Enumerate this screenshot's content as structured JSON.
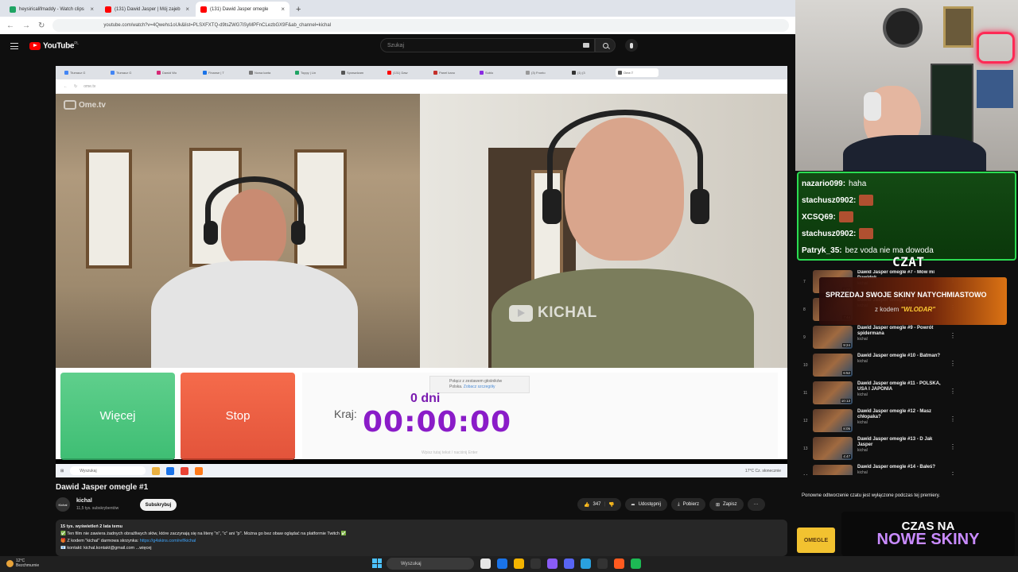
{
  "browser": {
    "tabs": [
      {
        "label": "heysiricalifmaddy - Watch clips",
        "color": "#1fa463"
      },
      {
        "label": "(131) Dawid Jasper | Mój zajeb",
        "color": "#ff0000"
      },
      {
        "label": "(131) Dawid Jasper omegle",
        "color": "#ff0000",
        "active": true
      }
    ],
    "new_tab": "+",
    "url": "youtube.com/watch?v=4Qwehs1oUk&list=PLSXFXTQ-d9tsZWG7iSyMPFnCLezbGX9F&ab_channel=kichal"
  },
  "youtube": {
    "logo": "YouTube",
    "logo_country": "PL",
    "search_placeholder": "Szukaj"
  },
  "player": {
    "inner_tabs": [
      "Tłumacz G",
      "Tłumacz G",
      "Dawid Wo",
      "Finanse | T",
      "Nowa karta",
      "Toppy | Lin",
      "Sprawdzam",
      "(131) Daw",
      "Panel kano",
      "Sublo",
      "(3) Fronto",
      "(1) (3",
      "Ome.T"
    ],
    "inner_url": "ome.tv",
    "site_logo": "Ome.tv",
    "watermark": "KICHAL",
    "more_button": "Więcej",
    "stop_button": "Stop",
    "country_label": "Kraj:",
    "days": "0 dni",
    "timer": "00:00:00",
    "notice_line1": "Połącz z zestawem głośników",
    "notice_line2a": "Polska.",
    "notice_line2b": "Zobacz szczegóły",
    "message_placeholder": "Wpisz tutaj tekst / naciśnij Enter",
    "taskbar_search": "Wyszukaj",
    "taskbar_tray": "17°C Cz. słonecznie"
  },
  "video": {
    "title": "Dawid Jasper omegle #1",
    "channel": "kichal",
    "channel_avatar": "Kichal",
    "subscribers": "11,5 tys. subskrybentów",
    "subscribe": "Subskrybuj",
    "likes": "347",
    "share": "Udostępnij",
    "download": "Pobierz",
    "save": "Zapisz",
    "more": "···",
    "desc_line1": "15 tys. wyświetleń  2 lata temu",
    "desc_line2": "✅ Ten film nie zawiera żadnych obraźliwych słów, które zaczynają się na literę \"n\", \"c\" ani \"p\". Można go bez obaw oglądać na platformie Twitch ✅",
    "desc_line3a": "🎁 Z kodem \"kichal\" darmowa skrzynka: ",
    "desc_line3b": "https://g4skins.com/ref/kichal",
    "desc_line4": "📧 kontakt: kichal.kontakt@gmail.com  ...więcej"
  },
  "stream_chat": {
    "messages": [
      {
        "user": "nazario099:",
        "text": "haha",
        "emote": false
      },
      {
        "user": "stachusz0902:",
        "text": "",
        "emote": true
      },
      {
        "user": "XCSQ69:",
        "text": "",
        "emote": true
      },
      {
        "user": "stachusz0902:",
        "text": "",
        "emote": true
      },
      {
        "user": "Patryk_35:",
        "text": "bez voda nie ma dowoda",
        "emote": false
      }
    ],
    "label": "CZAT"
  },
  "promo": {
    "line1": "SPRZEDAJ SWOJE SKINY NATYCHMIASTOWO",
    "line2_prefix": "z kodem",
    "line2_code": "\"WLODAR\""
  },
  "playlist": [
    {
      "num": "7",
      "title": "Dawid Jasper omegle #7 - Mów mi Dawidek",
      "channel": "kichal",
      "dur": "6:08"
    },
    {
      "num": "8",
      "title": "Dawid Jasper omegle #8",
      "channel": "kichal",
      "dur": "7:44"
    },
    {
      "num": "9",
      "title": "Dawid Jasper omegle #9 - Powrót spidermana",
      "channel": "kichal",
      "dur": "9:24"
    },
    {
      "num": "10",
      "title": "Dawid Jasper omegle #10 - Batman?",
      "channel": "kichal",
      "dur": "6:52"
    },
    {
      "num": "11",
      "title": "Dawid Jasper omegle #11 - POLSKA, USA I JAPONIA",
      "channel": "kichal",
      "dur": "10:13"
    },
    {
      "num": "12",
      "title": "Dawid Jasper omegle #12 - Masz chłopaka?",
      "channel": "kichal",
      "dur": "8:05"
    },
    {
      "num": "13",
      "title": "Dawid Jasper omegle #13 - D Jak Jasper",
      "channel": "kichal",
      "dur": "4:47"
    },
    {
      "num": "14",
      "title": "Dawid Jasper omegle #14 - Bałeś?",
      "channel": "kichal",
      "dur": ""
    }
  ],
  "chat_disabled": "Ponowne odtworzenie czatu jest wyłączone podczas tej premiery.",
  "cta": {
    "line1": "CZAS NA",
    "line2": "NOWE SKINY"
  },
  "omegle_logo": "OMEGLE",
  "taskbar": {
    "weather_temp": "12°C",
    "weather_desc": "Bezchmurnie",
    "search": "Wyszukaj",
    "app_colors": [
      "#e7e7e7",
      "#1a73e8",
      "#f4b400",
      "#333",
      "#8a5cf6",
      "#5865f2",
      "#2aa1de",
      "#333",
      "#ff5a1f",
      "#1db954"
    ]
  }
}
